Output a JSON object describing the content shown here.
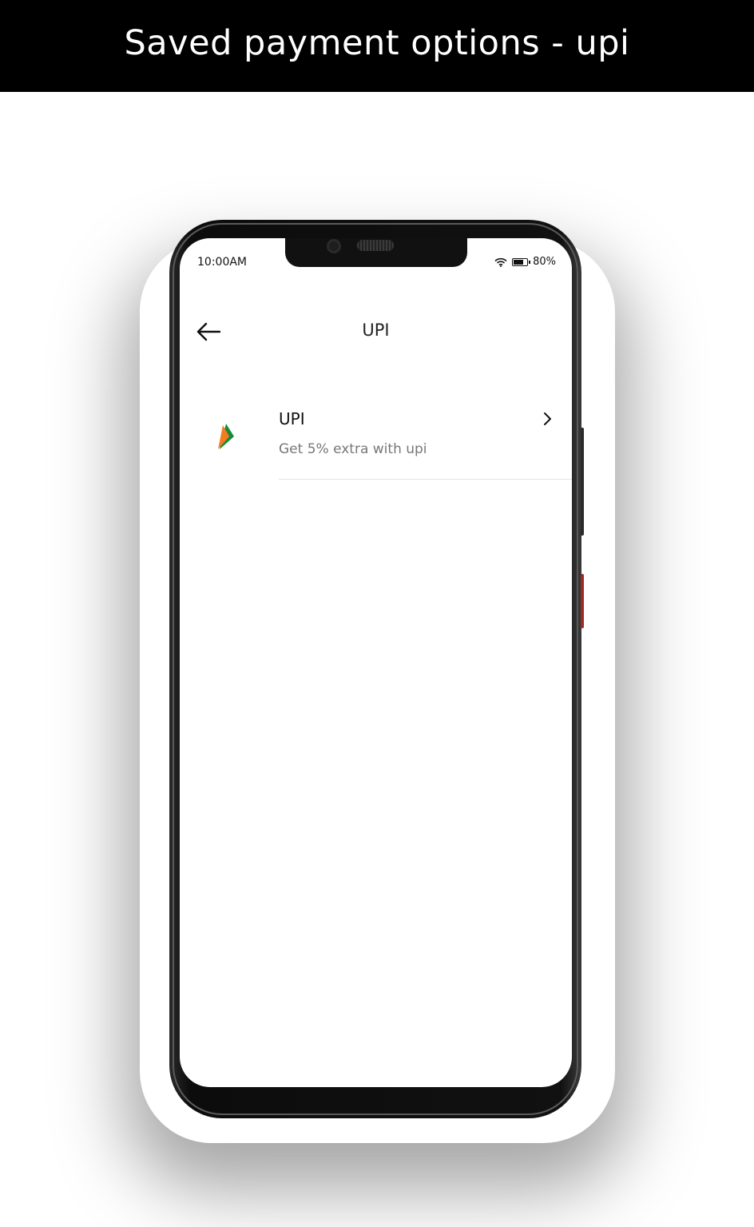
{
  "banner": {
    "title": "Saved payment options - upi"
  },
  "status_bar": {
    "time": "10:00AM",
    "battery": "80%",
    "icons": [
      "wifi-icon",
      "battery-icon"
    ]
  },
  "header": {
    "back_icon": "arrow-left-icon",
    "title": "UPI"
  },
  "payment_options": [
    {
      "name": "UPI",
      "description": "Get 5% extra with upi",
      "icon": "upi-logo-icon",
      "trailing_icon": "chevron-right-icon"
    }
  ],
  "colors": {
    "banner_bg": "#000000",
    "banner_text": "#ffffff",
    "upi_orange": "#f47b20",
    "upi_green": "#168a3a",
    "subtitle_gray": "#777777"
  }
}
